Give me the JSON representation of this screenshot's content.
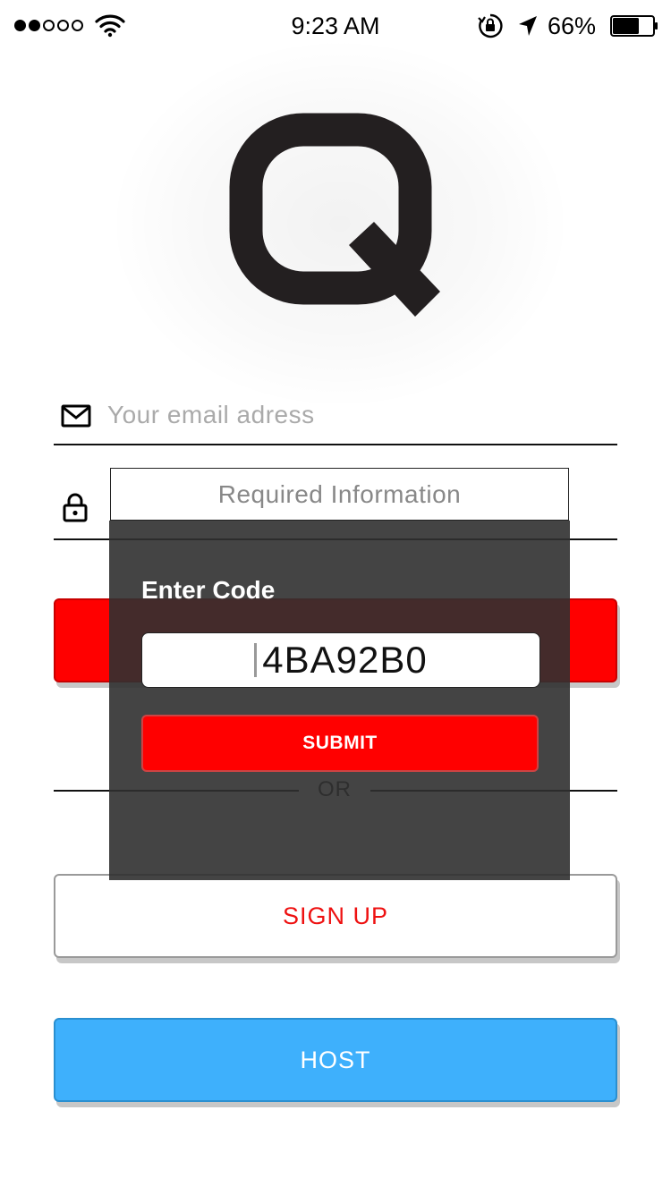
{
  "status_bar": {
    "signal_filled": 2,
    "signal_total": 5,
    "time": "9:23 AM",
    "battery_percent": "66%",
    "battery_level": 0.66
  },
  "logo": {
    "letter_icon": "q-logo-icon"
  },
  "email_field": {
    "icon": "mail-icon",
    "placeholder": "Your email adress"
  },
  "password_field": {
    "icon": "lock-icon"
  },
  "or_label": "OR",
  "signup_button": {
    "label": "SIGN UP"
  },
  "host_button": {
    "label": "HOST"
  },
  "validation_tooltip": {
    "text": "Required Information"
  },
  "code_dialog": {
    "title": "Enter Code",
    "code_value": "4BA92B0",
    "submit_label": "SUBMIT"
  },
  "colors": {
    "primary_red": "#ff0000",
    "signup_text": "#ee1111",
    "host_blue": "#3eb0fc",
    "dialog_bg": "#303030"
  }
}
